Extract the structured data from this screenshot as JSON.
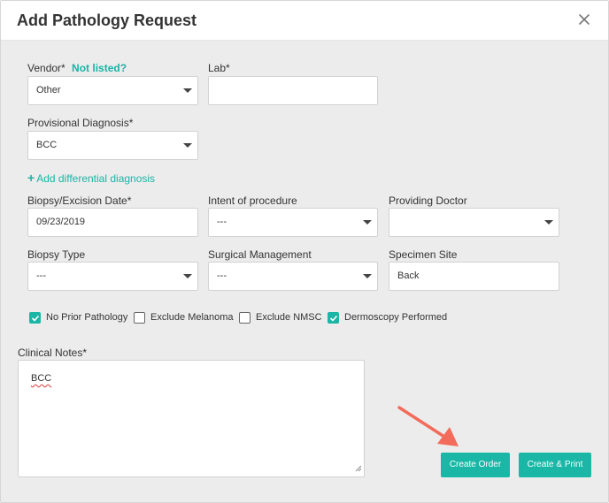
{
  "header": {
    "title": "Add Pathology Request"
  },
  "form": {
    "vendor": {
      "label": "Vendor*",
      "not_listed_link": "Not listed?",
      "value": "Other"
    },
    "lab": {
      "label": "Lab*",
      "value": ""
    },
    "provisional_diagnosis": {
      "label": "Provisional Diagnosis*",
      "value": "BCC"
    },
    "add_differential": {
      "label": "Add differential diagnosis"
    },
    "biopsy_date": {
      "label": "Biopsy/Excision Date*",
      "value": "09/23/2019"
    },
    "intent": {
      "label": "Intent of procedure",
      "value": "---"
    },
    "providing_doctor": {
      "label": "Providing Doctor",
      "value": ""
    },
    "biopsy_type": {
      "label": "Biopsy Type",
      "value": "---"
    },
    "surgical_management": {
      "label": "Surgical Management",
      "value": "---"
    },
    "specimen_site": {
      "label": "Specimen Site",
      "value": "Back"
    },
    "checkboxes": [
      {
        "label": "No Prior Pathology",
        "checked": true
      },
      {
        "label": "Exclude Melanoma",
        "checked": false
      },
      {
        "label": "Exclude NMSC",
        "checked": false
      },
      {
        "label": "Dermoscopy Performed",
        "checked": true
      }
    ],
    "clinical_notes": {
      "label": "Clinical Notes*",
      "value": "BCC"
    }
  },
  "actions": {
    "create_order": "Create Order",
    "create_print": "Create & Print"
  },
  "colors": {
    "accent": "#1ab7a6",
    "link": "#19b5a5",
    "annotation_arrow": "#f26b5b"
  }
}
